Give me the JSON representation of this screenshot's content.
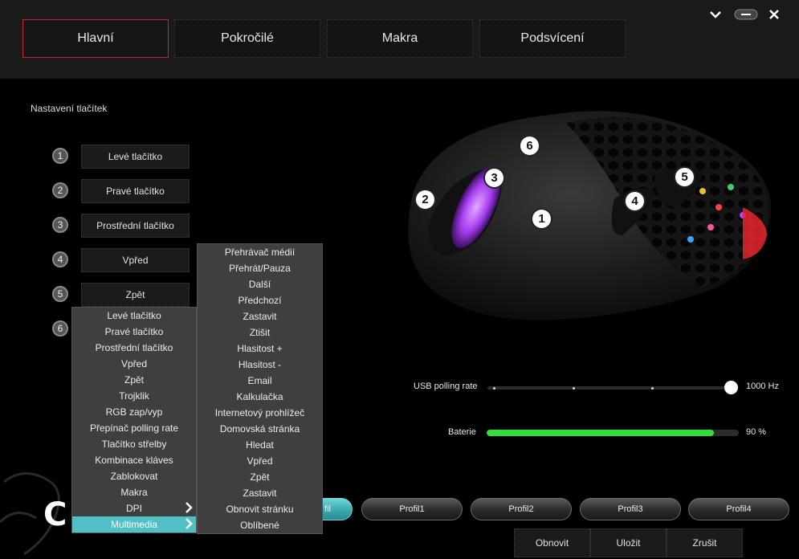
{
  "tabs": [
    "Hlavní",
    "Pokročilé",
    "Makra",
    "Podsvícení"
  ],
  "window_controls": {
    "collapse_icon": "chevron-down-icon",
    "minimize_icon": "minimize-icon",
    "close_icon": "close-icon"
  },
  "section_title": "Nastavení tlačítek",
  "buttons": [
    {
      "num": "1",
      "label": "Levé tlačítko"
    },
    {
      "num": "2",
      "label": "Pravé tlačítko"
    },
    {
      "num": "3",
      "label": "Prostřední tlačítko"
    },
    {
      "num": "4",
      "label": "Vpřed"
    },
    {
      "num": "5",
      "label": "Zpět"
    },
    {
      "num": "6",
      "label": ""
    }
  ],
  "dropdown_menu": [
    "Levé tlačítko",
    "Pravé tlačítko",
    "Prostřední tlačítko",
    "Vpřed",
    "Zpět",
    "Trojklik",
    "RGB zap/vyp",
    "Přepínač polling rate",
    "Tlačítko střelby",
    "Kombinace kláves",
    "Zablokovat",
    "Makra",
    "DPI",
    "Multimedia"
  ],
  "dropdown_selected": "Multimedia",
  "multimedia_submenu": [
    "Přehrávač médií",
    "Přehrát/Pauza",
    "Další",
    "Předchozí",
    "Zastavit",
    "Ztišit",
    "Hlasitost +",
    "Hlasitost -",
    "Email",
    "Kalkulačka",
    "Internetový prohlížeč",
    "Domovská stránka",
    "Hledat",
    "Vpřed",
    "Zpět",
    "Zastavit",
    "Obnovit stránku",
    "Oblíbené"
  ],
  "mouse_badges": [
    "1",
    "2",
    "3",
    "4",
    "5",
    "6"
  ],
  "polling": {
    "label": "USB polling rate",
    "value": "1000 Hz",
    "level": 1.0
  },
  "battery": {
    "label": "Baterie",
    "value": "90 %",
    "percent": 90
  },
  "profiles": [
    "fil",
    "Profil1",
    "Profil2",
    "Profil3",
    "Profil4"
  ],
  "actions": [
    "Obnovit",
    "Uložit",
    "Zrušit"
  ],
  "logo_text": "C",
  "colors": {
    "accent_red": "#c8262d",
    "accent_cyan": "#4fc0c6",
    "battery_green": "#2de03a"
  }
}
